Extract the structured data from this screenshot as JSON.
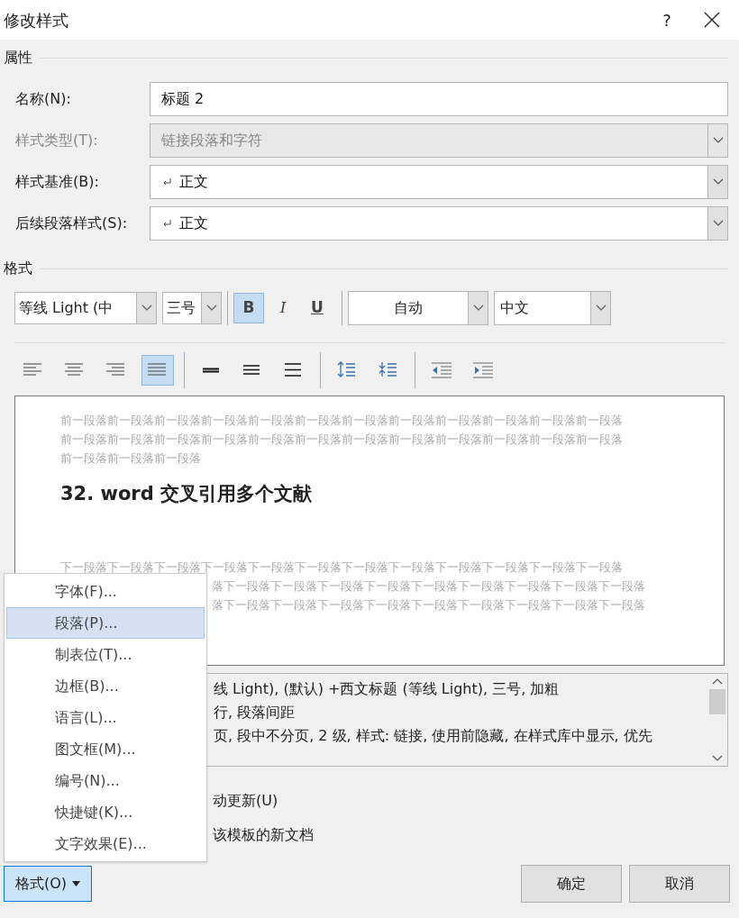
{
  "window": {
    "title": "修改样式",
    "help": "?"
  },
  "properties": {
    "heading": "属性",
    "rows": [
      {
        "label": "名称(N):",
        "kind": "text",
        "value": "标题 2",
        "disabled": false
      },
      {
        "label": "样式类型(T):",
        "kind": "combo",
        "value": "链接段落和字符",
        "disabled": true,
        "return_mark": false
      },
      {
        "label": "样式基准(B):",
        "kind": "combo",
        "value": "正文",
        "disabled": false,
        "return_mark": true
      },
      {
        "label": "后续段落样式(S):",
        "kind": "combo",
        "value": "正文",
        "disabled": false,
        "return_mark": true
      }
    ]
  },
  "format": {
    "heading": "格式",
    "font": "等线 Light (中",
    "size": "三号",
    "styles": [
      {
        "kind": "bold",
        "label": "B",
        "selected": true
      },
      {
        "kind": "italic",
        "label": "I",
        "selected": false
      },
      {
        "kind": "underline",
        "label": "U",
        "selected": false
      }
    ],
    "font_color_value": "自动",
    "language": "中文",
    "paragraph_tools": [
      {
        "kind": "align-left",
        "selected": false
      },
      {
        "kind": "align-center",
        "selected": false
      },
      {
        "kind": "align-right",
        "selected": false
      },
      {
        "kind": "align-justify",
        "selected": true
      },
      {
        "kind": "sep"
      },
      {
        "kind": "single",
        "selected": false
      },
      {
        "kind": "onehalf",
        "selected": false
      },
      {
        "kind": "double",
        "selected": false
      },
      {
        "kind": "sep"
      },
      {
        "kind": "space-inc",
        "selected": false
      },
      {
        "kind": "space-dec",
        "selected": false
      },
      {
        "kind": "sep"
      },
      {
        "kind": "indent-dec",
        "selected": false
      },
      {
        "kind": "indent-inc",
        "selected": false
      }
    ]
  },
  "preview": {
    "before": [
      "前一段落前一段落前一段落前一段落前一段落前一段落前一段落前一段落前一段落前一段落前一段落前一段落",
      "前一段落前一段落前一段落前一段落前一段落前一段落前一段落前一段落前一段落前一段落前一段落前一段落",
      "前一段落前一段落前一段落"
    ],
    "sample": "32. word 交叉引用多个文献",
    "after": [
      "下一段落下一段落下一段落下一段落下一段落下一段落下一段落下一段落下一段落下一段落下一段落下一段落",
      "落下一段落下一段落下一段落下一段落下一段落下一段落下一段落下一段落下一段落",
      "落下一段落下一段落下一段落下一段落下一段落下一段落下一段落下一段落下一段落"
    ]
  },
  "description": [
    "线 Light), (默认) +西文标题 (等线 Light), 三号, 加粗",
    "行, 段落间距",
    "页, 段中不分页, 2 级, 样式: 链接, 使用前隐藏, 在样式库中显示, 优先"
  ],
  "options": [
    {
      "label": "动更新(U)"
    },
    {
      "label": "该模板的新文档"
    }
  ],
  "format_menu": {
    "button": "格式(O)",
    "expanded": true,
    "items": [
      {
        "label": "字体(F)...",
        "selected": false
      },
      {
        "label": "段落(P)...",
        "selected": true
      },
      {
        "label": "制表位(T)...",
        "selected": false
      },
      {
        "label": "边框(B)...",
        "selected": false
      },
      {
        "label": "语言(L)...",
        "selected": false
      },
      {
        "label": "图文框(M)...",
        "selected": false
      },
      {
        "label": "编号(N)...",
        "selected": false
      },
      {
        "label": "快捷键(K)...",
        "selected": false
      },
      {
        "label": "文字效果(E)...",
        "selected": false
      }
    ]
  },
  "buttons": [
    "确定",
    "取消"
  ]
}
